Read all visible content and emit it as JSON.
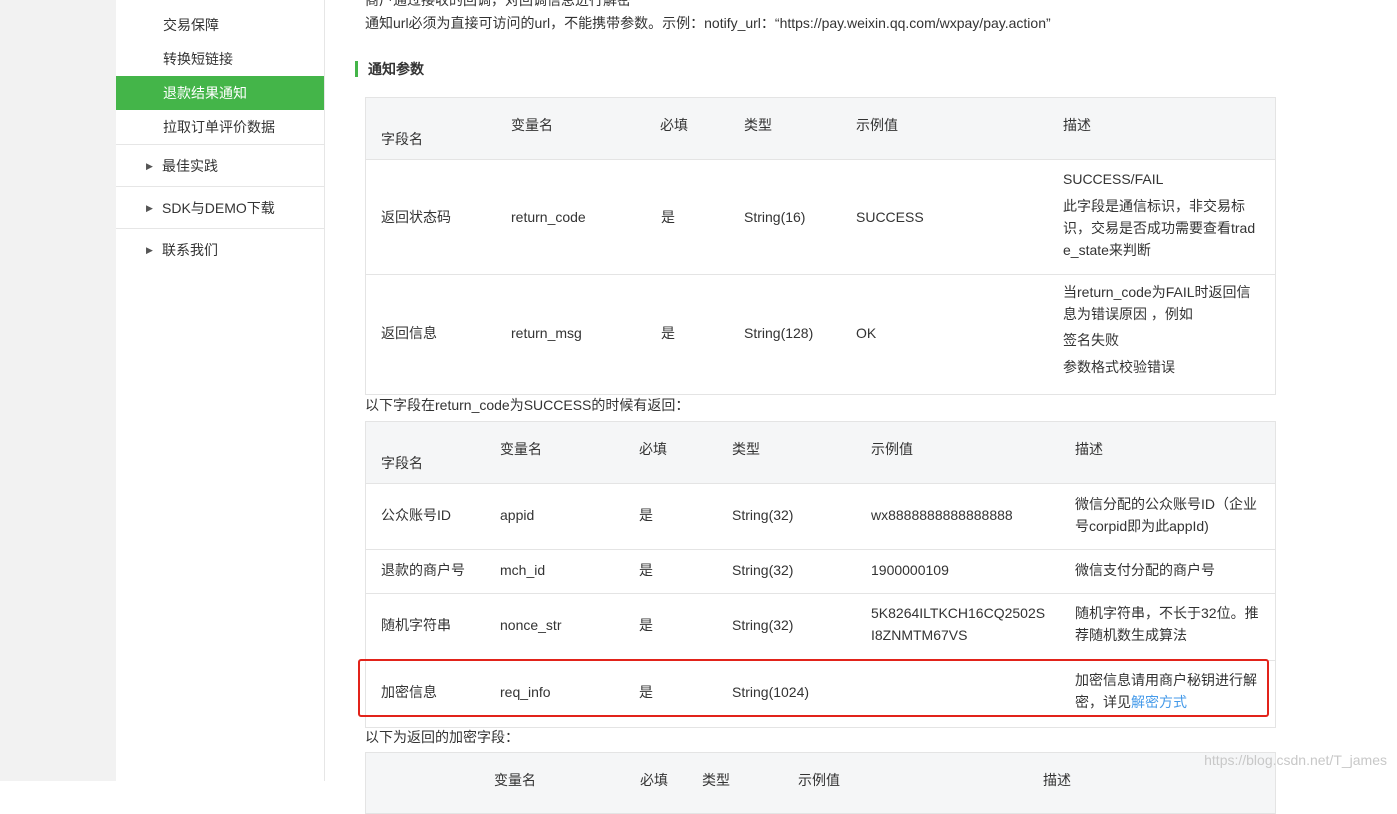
{
  "sidebar": {
    "sub_items": [
      "交易保障",
      "转换短链接",
      "退款结果通知",
      "拉取订单评价数据"
    ],
    "groups": [
      "最佳实践",
      "SDK与DEMO下载",
      "联系我们"
    ]
  },
  "content": {
    "top_clipped": "商户通过接收的回调，对回调信息进行解密",
    "url_note": "通知url必须为直接可访问的url，不能携带参数。示例：notify_url：“https://pay.weixin.qq.com/wxpay/pay.action”",
    "section_title": "通知参数",
    "headers": [
      "字段名",
      "变量名",
      "必填",
      "类型",
      "示例值",
      "描述"
    ],
    "table1": [
      {
        "name": "返回状态码",
        "var": "return_code",
        "req": "是",
        "type": "String(16)",
        "example": "SUCCESS",
        "desc": [
          "SUCCESS/FAIL",
          "此字段是通信标识，非交易标识，交易是否成功需要查看trade_state来判断"
        ]
      },
      {
        "name": "返回信息",
        "var": "return_msg",
        "req": "是",
        "type": "String(128)",
        "example": "OK",
        "desc": [
          "当return_code为FAIL时返回信息为错误原因 ，例如",
          "签名失败",
          "参数格式校验错误"
        ]
      }
    ],
    "caption2": "以下字段在return_code为SUCCESS的时候有返回：",
    "table2": [
      {
        "name": "公众账号ID",
        "var": "appid",
        "req": "是",
        "type": "String(32)",
        "example": "wx8888888888888888",
        "desc": "微信分配的公众账号ID（企业号corpid即为此appId)"
      },
      {
        "name": "退款的商户号",
        "var": "mch_id",
        "req": "是",
        "type": "String(32)",
        "example": "1900000109",
        "desc": "微信支付分配的商户号"
      },
      {
        "name": "随机字符串",
        "var": "nonce_str",
        "req": "是",
        "type": "String(32)",
        "example": "5K8264ILTKCH16CQ2502SI8ZNMTM67VS",
        "desc": "随机字符串，不长于32位。推荐随机数生成算法"
      },
      {
        "name": "加密信息",
        "var": "req_info",
        "req": "是",
        "type": "String(1024)",
        "example": "",
        "desc": "加密信息请用商户秘钥进行解密，详见",
        "desc_link": "解密方式"
      }
    ],
    "caption3": "以下为返回的加密字段：",
    "table3_headers": [
      "变量名",
      "必填",
      "类型",
      "示例值",
      "描述"
    ]
  },
  "watermark": "https://blog.csdn.net/T_james",
  "colors": {
    "accent": "#44b549",
    "highlight": "#e2231a",
    "link": "#459ae9"
  }
}
